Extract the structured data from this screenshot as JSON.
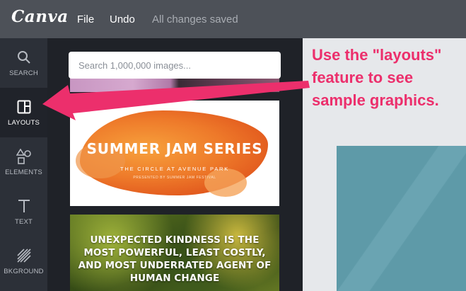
{
  "app": {
    "logo": "Canva"
  },
  "topbar": {
    "file": "File",
    "undo": "Undo",
    "status": "All changes saved"
  },
  "sidebar": {
    "items": [
      {
        "label": "SEARCH",
        "icon": "search-icon",
        "active": false
      },
      {
        "label": "LAYOUTS",
        "icon": "layouts-icon",
        "active": true
      },
      {
        "label": "ELEMENTS",
        "icon": "elements-icon",
        "active": false
      },
      {
        "label": "TEXT",
        "icon": "text-icon",
        "active": false
      },
      {
        "label": "BKGROUND",
        "icon": "background-icon",
        "active": false
      }
    ]
  },
  "panel": {
    "search_placeholder": "Search 1,000,000 images...",
    "layouts": [
      {
        "title": "SUMMER JAM SERIES",
        "subtitle": "THE CIRCLE AT AVENUE PARK",
        "small": "PRESENTED BY SUMMER JAM FESTIVAL"
      },
      {
        "quote_lines": [
          "UNEXPECTED KINDNESS IS THE",
          "MOST POWERFUL, LEAST COSTLY,",
          "AND MOST UNDERRATED AGENT OF",
          "HUMAN CHANGE"
        ]
      }
    ]
  },
  "annotation": {
    "lines": [
      "Use the \"layouts\"",
      "feature to see",
      "sample graphics."
    ],
    "color": "#ec2f6c"
  },
  "colors": {
    "topbar": "#4d5158",
    "sidebar": "#2c3038",
    "panel": "#1f2228",
    "canvas": "#5e9aa8"
  }
}
